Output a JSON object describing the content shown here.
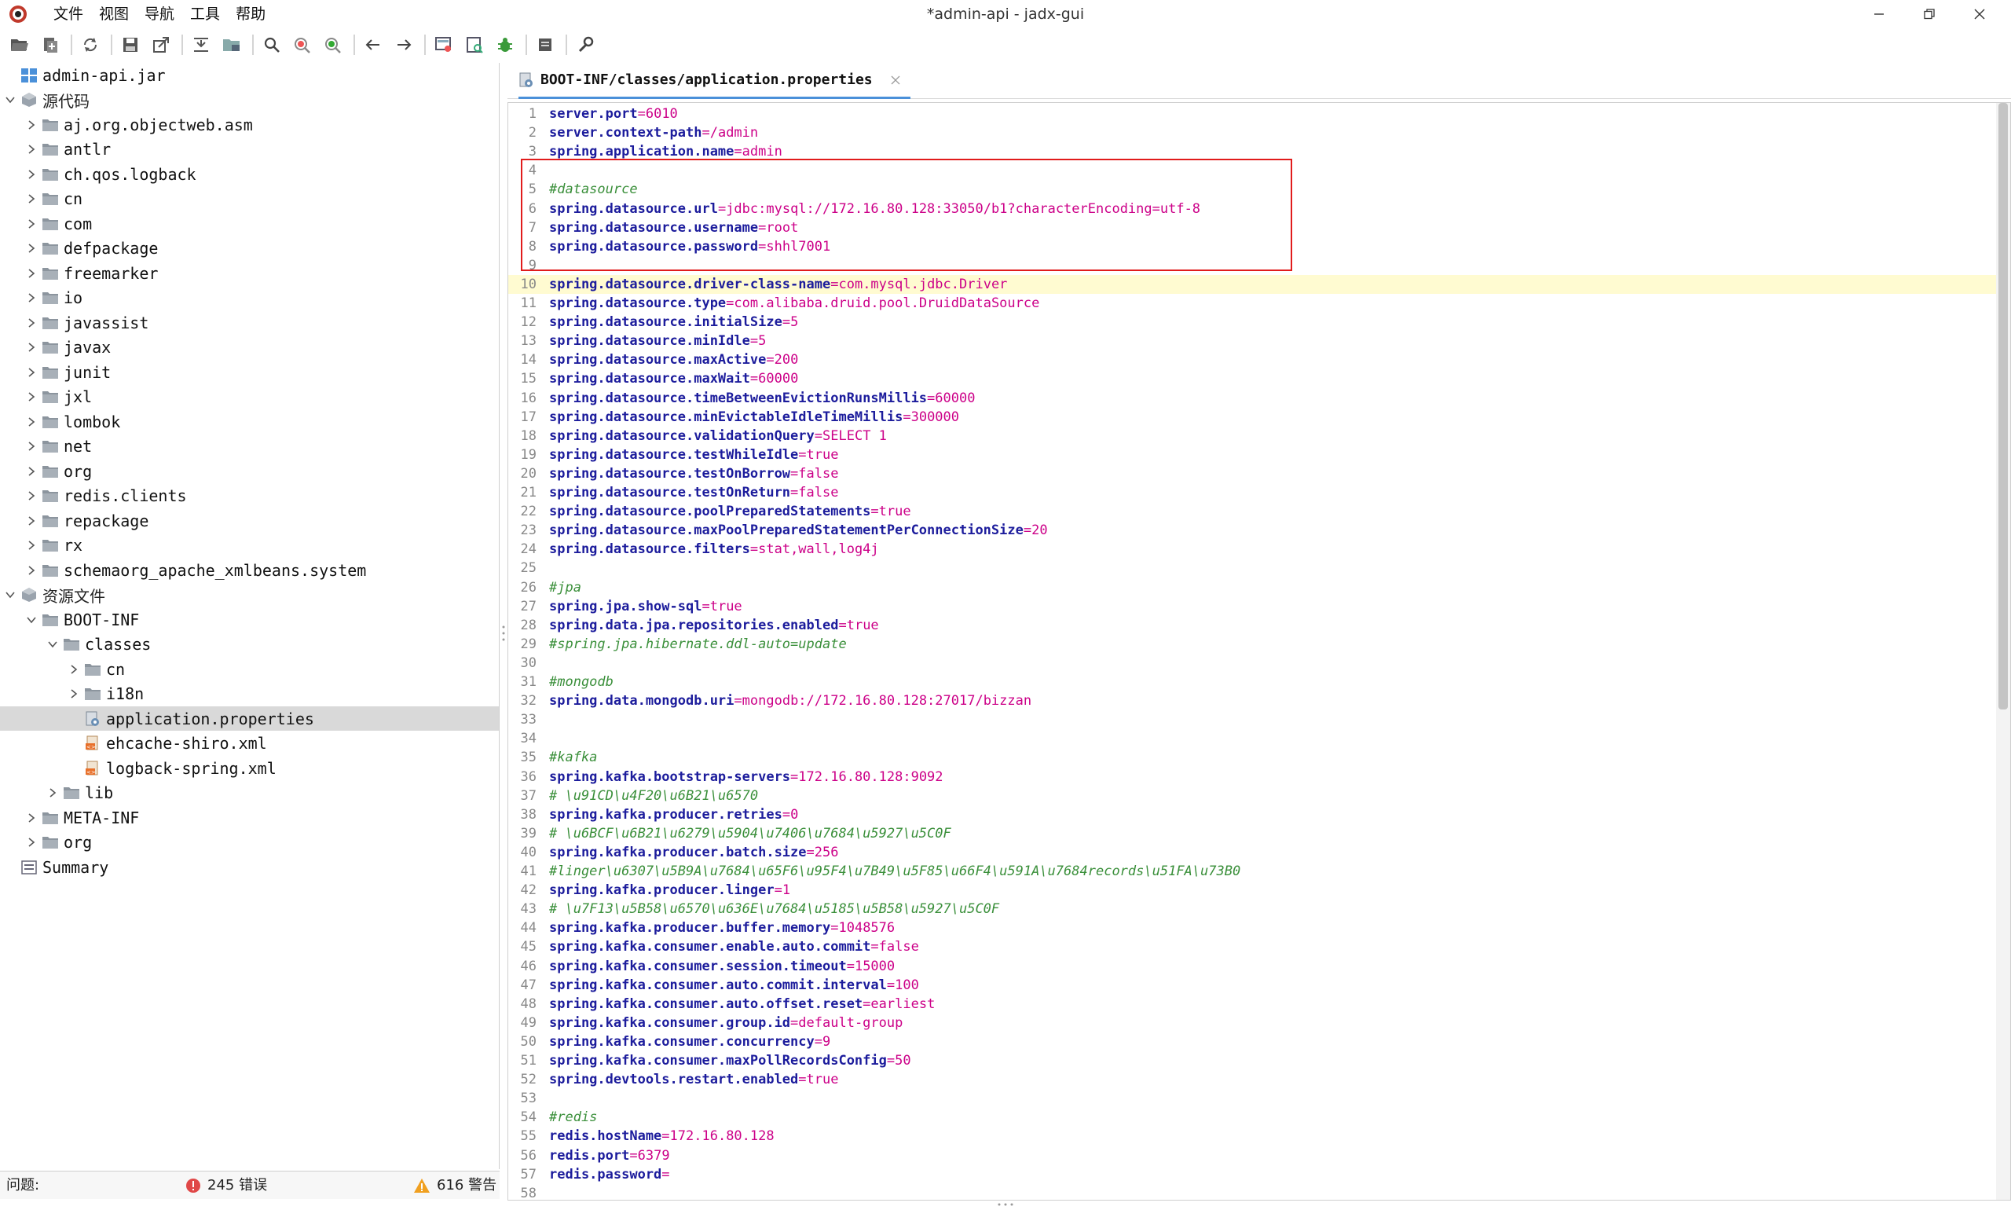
{
  "window": {
    "title": "*admin-api - jadx-gui",
    "menu": [
      "文件",
      "视图",
      "导航",
      "工具",
      "帮助"
    ]
  },
  "toolbar": {
    "buttons": [
      "open-file",
      "add-files",
      "reload",
      "save",
      "export",
      "sync",
      "flatten",
      "search",
      "find-class",
      "find-usage",
      "back",
      "forward",
      "decompile-all",
      "deobfuscation",
      "debug",
      "log",
      "preferences"
    ]
  },
  "tree": {
    "root": "admin-api.jar",
    "source_group": "源代码",
    "packages": [
      "aj.org.objectweb.asm",
      "antlr",
      "ch.qos.logback",
      "cn",
      "com",
      "defpackage",
      "freemarker",
      "io",
      "javassist",
      "javax",
      "junit",
      "jxl",
      "lombok",
      "net",
      "org",
      "redis.clients",
      "repackage",
      "rx",
      "schemaorg_apache_xmlbeans.system"
    ],
    "resources_group": "资源文件",
    "boot_inf": "BOOT-INF",
    "classes": "classes",
    "classes_children": [
      "cn",
      "i18n"
    ],
    "files": [
      "application.properties",
      "ehcache-shiro.xml",
      "logback-spring.xml"
    ],
    "lib": "lib",
    "meta_inf": "META-INF",
    "res_org": "org",
    "summary": "Summary",
    "selected": "application.properties"
  },
  "status": {
    "problems_label": "问题:",
    "errors": "245 错误",
    "warnings": "616 警告"
  },
  "colors": {
    "key": "#1c1c9c",
    "value": "#cc0088",
    "comment": "#3a8f3a",
    "highlight_box": "#e11c1c",
    "current_line": "#fffbd1"
  },
  "editor": {
    "tab": "BOOT-INF/classes/application.properties",
    "current_line": 10,
    "highlighted_lines": [
      4,
      9
    ],
    "lines": [
      {
        "k": "server.port",
        "v": "6010"
      },
      {
        "k": "server.context-path",
        "v": "/admin"
      },
      {
        "k": "spring.application.name",
        "v": "admin"
      },
      {},
      {
        "c": "#datasource"
      },
      {
        "k": "spring.datasource.url",
        "v": "jdbc:mysql://172.16.80.128:33050/b1?characterEncoding=utf-8"
      },
      {
        "k": "spring.datasource.username",
        "v": "root"
      },
      {
        "k": "spring.datasource.password",
        "v": "shhl7001"
      },
      {},
      {
        "k": "spring.datasource.driver-class-name",
        "v": "com.mysql.jdbc.Driver"
      },
      {
        "k": "spring.datasource.type",
        "v": "com.alibaba.druid.pool.DruidDataSource"
      },
      {
        "k": "spring.datasource.initialSize",
        "v": "5"
      },
      {
        "k": "spring.datasource.minIdle",
        "v": "5"
      },
      {
        "k": "spring.datasource.maxActive",
        "v": "200"
      },
      {
        "k": "spring.datasource.maxWait",
        "v": "60000"
      },
      {
        "k": "spring.datasource.timeBetweenEvictionRunsMillis",
        "v": "60000"
      },
      {
        "k": "spring.datasource.minEvictableIdleTimeMillis",
        "v": "300000"
      },
      {
        "k": "spring.datasource.validationQuery",
        "v": "SELECT 1"
      },
      {
        "k": "spring.datasource.testWhileIdle",
        "v": "true"
      },
      {
        "k": "spring.datasource.testOnBorrow",
        "v": "false"
      },
      {
        "k": "spring.datasource.testOnReturn",
        "v": "false"
      },
      {
        "k": "spring.datasource.poolPreparedStatements",
        "v": "true"
      },
      {
        "k": "spring.datasource.maxPoolPreparedStatementPerConnectionSize",
        "v": "20"
      },
      {
        "k": "spring.datasource.filters",
        "v": "stat,wall,log4j"
      },
      {},
      {
        "c": "#jpa"
      },
      {
        "k": "spring.jpa.show-sql",
        "v": "true"
      },
      {
        "k": "spring.data.jpa.repositories.enabled",
        "v": "true"
      },
      {
        "c": "#spring.jpa.hibernate.ddl-auto=update"
      },
      {},
      {
        "c": "#mongodb"
      },
      {
        "k": "spring.data.mongodb.uri",
        "v": "mongodb://172.16.80.128:27017/bizzan"
      },
      {},
      {},
      {
        "c": "#kafka"
      },
      {
        "k": "spring.kafka.bootstrap-servers",
        "v": "172.16.80.128:9092"
      },
      {
        "c": "# \\u91CD\\u4F20\\u6B21\\u6570"
      },
      {
        "k": "spring.kafka.producer.retries",
        "v": "0"
      },
      {
        "c": "# \\u6BCF\\u6B21\\u6279\\u5904\\u7406\\u7684\\u5927\\u5C0F"
      },
      {
        "k": "spring.kafka.producer.batch.size",
        "v": "256"
      },
      {
        "c": "#linger\\u6307\\u5B9A\\u7684\\u65F6\\u95F4\\u7B49\\u5F85\\u66F4\\u591A\\u7684records\\u51FA\\u73B0"
      },
      {
        "k": "spring.kafka.producer.linger",
        "v": "1"
      },
      {
        "c": "# \\u7F13\\u5B58\\u6570\\u636E\\u7684\\u5185\\u5B58\\u5927\\u5C0F"
      },
      {
        "k": "spring.kafka.producer.buffer.memory",
        "v": "1048576"
      },
      {
        "k": "spring.kafka.consumer.enable.auto.commit",
        "v": "false"
      },
      {
        "k": "spring.kafka.consumer.session.timeout",
        "v": "15000"
      },
      {
        "k": "spring.kafka.consumer.auto.commit.interval",
        "v": "100"
      },
      {
        "k": "spring.kafka.consumer.auto.offset.reset",
        "v": "earliest"
      },
      {
        "k": "spring.kafka.consumer.group.id",
        "v": "default-group"
      },
      {
        "k": "spring.kafka.consumer.concurrency",
        "v": "9"
      },
      {
        "k": "spring.kafka.consumer.maxPollRecordsConfig",
        "v": "50"
      },
      {
        "k": "spring.devtools.restart.enabled",
        "v": "true"
      },
      {},
      {
        "c": "#redis"
      },
      {
        "k": "redis.hostName",
        "v": "172.16.80.128"
      },
      {
        "k": "redis.port",
        "v": "6379"
      },
      {
        "k": "redis.password",
        "v": ""
      },
      {}
    ]
  }
}
